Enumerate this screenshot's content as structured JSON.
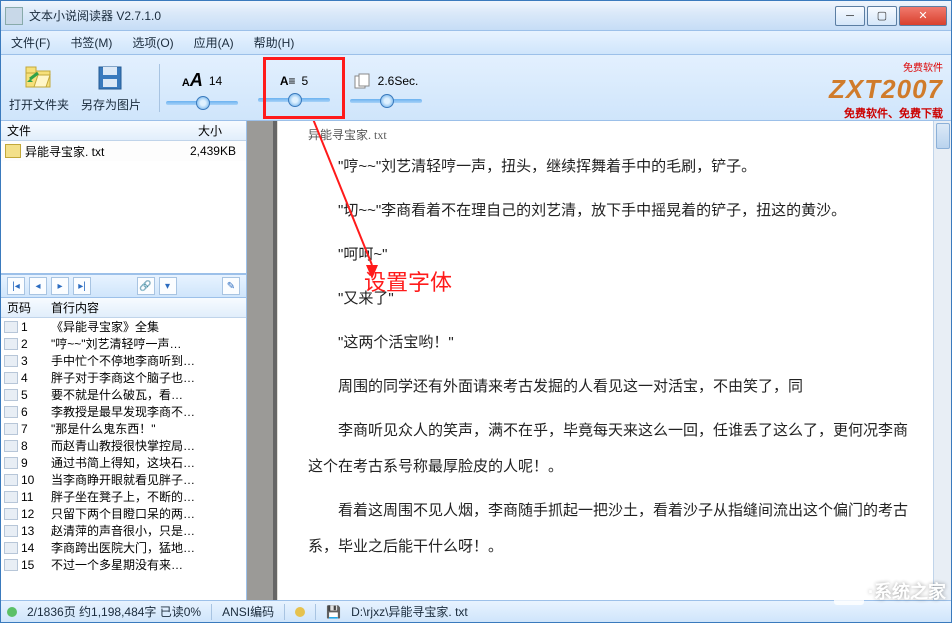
{
  "window": {
    "title": "文本小说阅读器 V2.7.1.0"
  },
  "menu": {
    "file": "文件(F)",
    "bookmark": "书签(M)",
    "options": "选项(O)",
    "app": "应用(A)",
    "help": "帮助(H)"
  },
  "toolbar": {
    "open_folder": "打开文件夹",
    "save_as_image": "另存为图片",
    "font_size": "14",
    "line_spacing": "5",
    "interval": "2.6Sec."
  },
  "brand": {
    "free": "免费软件",
    "logo_a": "ZXT",
    "logo_b": "2007",
    "sub": "免费软件、免费下载"
  },
  "file_pane": {
    "col_name": "文件",
    "col_size": "大小",
    "rows": [
      {
        "name": "异能寻宝家. txt",
        "size": "2,439KB"
      }
    ]
  },
  "chapter_pane": {
    "col_page": "页码",
    "col_first": "首行内容",
    "rows": [
      {
        "n": "1",
        "t": "《异能寻宝家》全集"
      },
      {
        "n": "2",
        "t": "\"哼~~\"刘艺清轻哼一声…"
      },
      {
        "n": "3",
        "t": "手中忙个不停地李商听到…"
      },
      {
        "n": "4",
        "t": "胖子对于李商这个脑子也…"
      },
      {
        "n": "5",
        "t": "要不就是什么破瓦，看…"
      },
      {
        "n": "6",
        "t": "李教授是最早发现李商不…"
      },
      {
        "n": "7",
        "t": "\"那是什么鬼东西！\""
      },
      {
        "n": "8",
        "t": "而赵青山教授很快掌控局…"
      },
      {
        "n": "9",
        "t": "通过书简上得知，这块石…"
      },
      {
        "n": "10",
        "t": "当李商睁开眼就看见胖子…"
      },
      {
        "n": "11",
        "t": "胖子坐在凳子上，不断的…"
      },
      {
        "n": "12",
        "t": "只留下两个目瞪口呆的两…"
      },
      {
        "n": "13",
        "t": "赵清萍的声音很小，只是…"
      },
      {
        "n": "14",
        "t": "李商跨出医院大门，猛地…"
      },
      {
        "n": "15",
        "t": "不过一个多星期没有来…"
      }
    ]
  },
  "reader": {
    "tab": "异能寻宝家. txt",
    "paras": [
      "\"哼~~\"刘艺清轻哼一声，扭头，继续挥舞着手中的毛刷，铲子。",
      "\"切~~\"李商看着不在理自己的刘艺清，放下手中摇晃着的铲子，扭这的黄沙。",
      "\"呵呵~\"",
      "\"又来了\"",
      "\"这两个活宝哟！\"",
      "周围的同学还有外面请来考古发掘的人看见这一对活宝，不由笑了，同",
      "李商听见众人的笑声，满不在乎，毕竟每天来这么一回，任谁丢了这么了，更何况李商这个在考古系号称最厚脸皮的人呢！。",
      "看着这周围不见人烟，李商随手抓起一把沙土，看着沙子从指缝间流出这个偏门的考古系，毕业之后能干什么呀！。"
    ]
  },
  "annotation": {
    "label": "设置字体"
  },
  "status": {
    "pages": "2/1836页 约1,198,484字 已读0%",
    "encoding": "ANSI编码",
    "path": "D:\\rjxz\\异能寻宝家. txt"
  },
  "watermark": "·系统之家"
}
